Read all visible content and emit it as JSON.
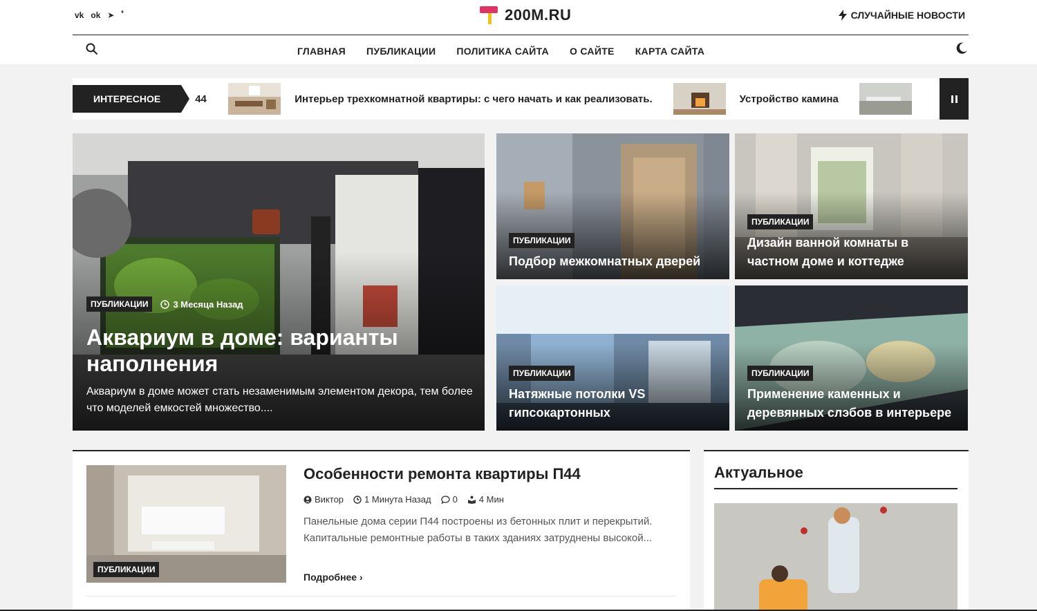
{
  "header": {
    "social": [
      "vk",
      "ok",
      "telegram",
      "yandex-zen"
    ],
    "logo": "200M.RU",
    "random_news": "СЛУЧАЙНЫЕ НОВОСТИ"
  },
  "nav": [
    "ГЛАВНАЯ",
    "ПУБЛИКАЦИИ",
    "ПОЛИТИКА САЙТА",
    "О САЙТЕ",
    "КАРТА САЙТА"
  ],
  "ticker": {
    "label": "ИНТЕРЕСНОЕ",
    "number": "44",
    "items": [
      "Интерьер трехкомнатной квартиры: с чего начать и как реализовать.",
      "Устройство камина"
    ]
  },
  "hero": {
    "category": "ПУБЛИКАЦИИ",
    "time": "3 Месяца Назад",
    "title": "Аквариум в доме: варианты наполнения",
    "excerpt": "Аквариум в доме может стать незаменимым элементом декора, тем более что моделей емкостей множество...."
  },
  "cards": [
    {
      "category": "ПУБЛИКАЦИИ",
      "title": "Подбор межкомнатных дверей"
    },
    {
      "category": "ПУБЛИКАЦИИ",
      "title": "Дизайн ванной комнаты в частном доме и коттедже"
    },
    {
      "category": "ПУБЛИКАЦИИ",
      "title": "Натяжные потолки VS гипсокартонных"
    },
    {
      "category": "ПУБЛИКАЦИИ",
      "title": "Применение каменных и деревянных слэбов в интерьере"
    }
  ],
  "post": {
    "category": "ПУБЛИКАЦИИ",
    "title": "Особенности ремонта квартиры П44",
    "author": "Виктор",
    "time": "1 Минута Назад",
    "comments": "0",
    "read_time": "4 Мин",
    "excerpt": "Панельные дома серии П44 построены из бетонных плит и перекрытий. Капитальные ремонтные работы в таких зданиях затруднены высокой...",
    "read_more": "Подробнее"
  },
  "sidebar": {
    "title": "Актуальное"
  }
}
